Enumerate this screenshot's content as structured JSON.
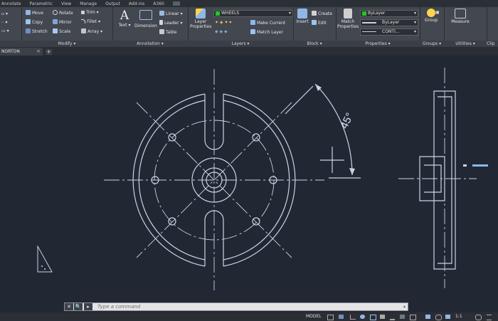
{
  "menu": [
    "Annotate",
    "Parametric",
    "View",
    "Manage",
    "Output",
    "Add-ins",
    "A360"
  ],
  "modify": {
    "rows": [
      [
        "Move",
        "Rotate",
        "Trim"
      ],
      [
        "Copy",
        "Mirror",
        "Fillet"
      ],
      [
        "Stretch",
        "Scale",
        "Array"
      ]
    ],
    "title": "Modify"
  },
  "annotation": {
    "text": "Text",
    "dimension": "Dimension",
    "linear": "Linear",
    "leader": "Leader",
    "table": "Table",
    "title": "Annotation"
  },
  "layers": {
    "layer_properties": "Layer\nProperties",
    "layer_name": "WHEELS",
    "make_current": "Make Current",
    "match_layer": "Match Layer",
    "title": "Layers"
  },
  "block": {
    "insert": "Insert",
    "create": "Create",
    "edit": "Edit",
    "title": "Block"
  },
  "properties": {
    "match": "Match\nProperties",
    "color": "ByLayer",
    "linetype": "ByLayer",
    "lineweight": "CONTI...",
    "title": "Properties"
  },
  "groups": {
    "group": "Group",
    "title": "Groups"
  },
  "utilities": {
    "measure": "Measure",
    "title": "Utilities"
  },
  "clipboard": {
    "title": "Clip"
  },
  "document_tab": "NORTON",
  "new_tab": "+",
  "drawing": {
    "dimension_text": "45°"
  },
  "command": {
    "placeholder": "Type a command",
    "close": "✕",
    "search": "🔍",
    "prompt": "▸"
  },
  "status": {
    "model": "MODEL",
    "scale": "1:1"
  },
  "colors": {
    "canvas": "#212834",
    "geometry": "#c8d4e6",
    "ribbon": "#424750",
    "green_swatch": "#21c42a"
  }
}
